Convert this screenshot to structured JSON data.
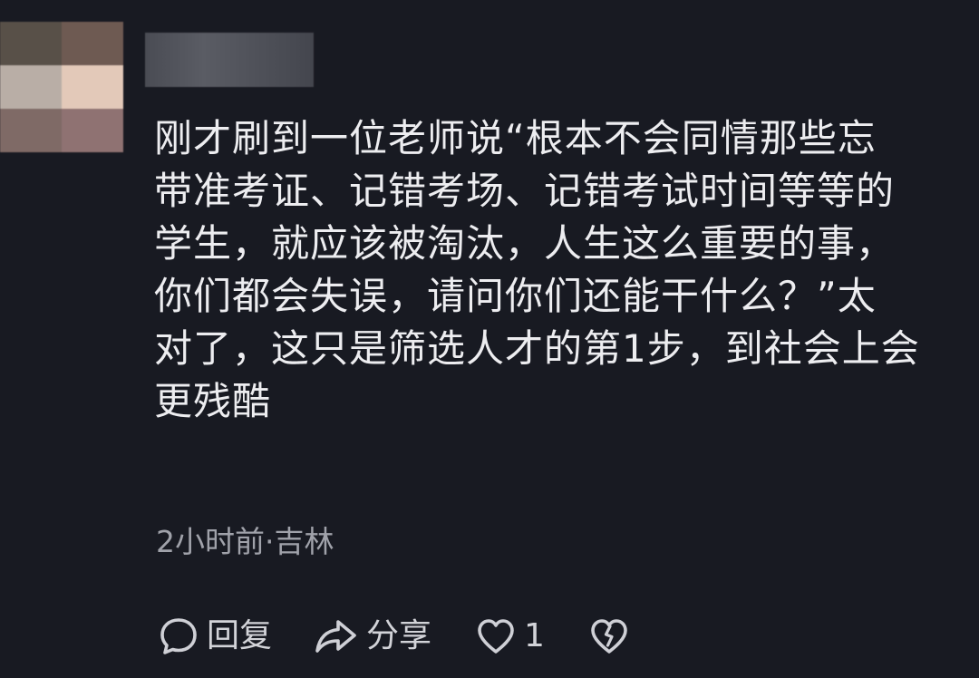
{
  "comment": {
    "author_name": "",
    "lines": [
      "刚才刷到一位老师说“根本不会同情那些忘",
      "带准考证、记错考场、记错考试时间等等的",
      "学生，就应该被淘汰，人生这么重要的事，",
      "你们都会失误，请问你们还能干什么？”太",
      "对了，这只是筛选人才的第1步，到社会上会",
      "更残酷"
    ],
    "meta": "2小时前·吉林"
  },
  "actions": {
    "reply_label": "回复",
    "share_label": "分享",
    "like_count": "1"
  },
  "icons": {
    "reply": "speech-bubble-icon",
    "share": "share-arrow-icon",
    "like": "heart-icon",
    "dislike": "broken-heart-icon"
  },
  "colors": {
    "background": "#181a22",
    "text": "#ededf0",
    "meta": "#a0a2aa",
    "icon": "#cfd0d6",
    "avatar_pixels": [
      "#585048",
      "#6e5a52",
      "#b9aea6",
      "#e3c9b9",
      "#7f6a66",
      "#8f7272"
    ]
  }
}
